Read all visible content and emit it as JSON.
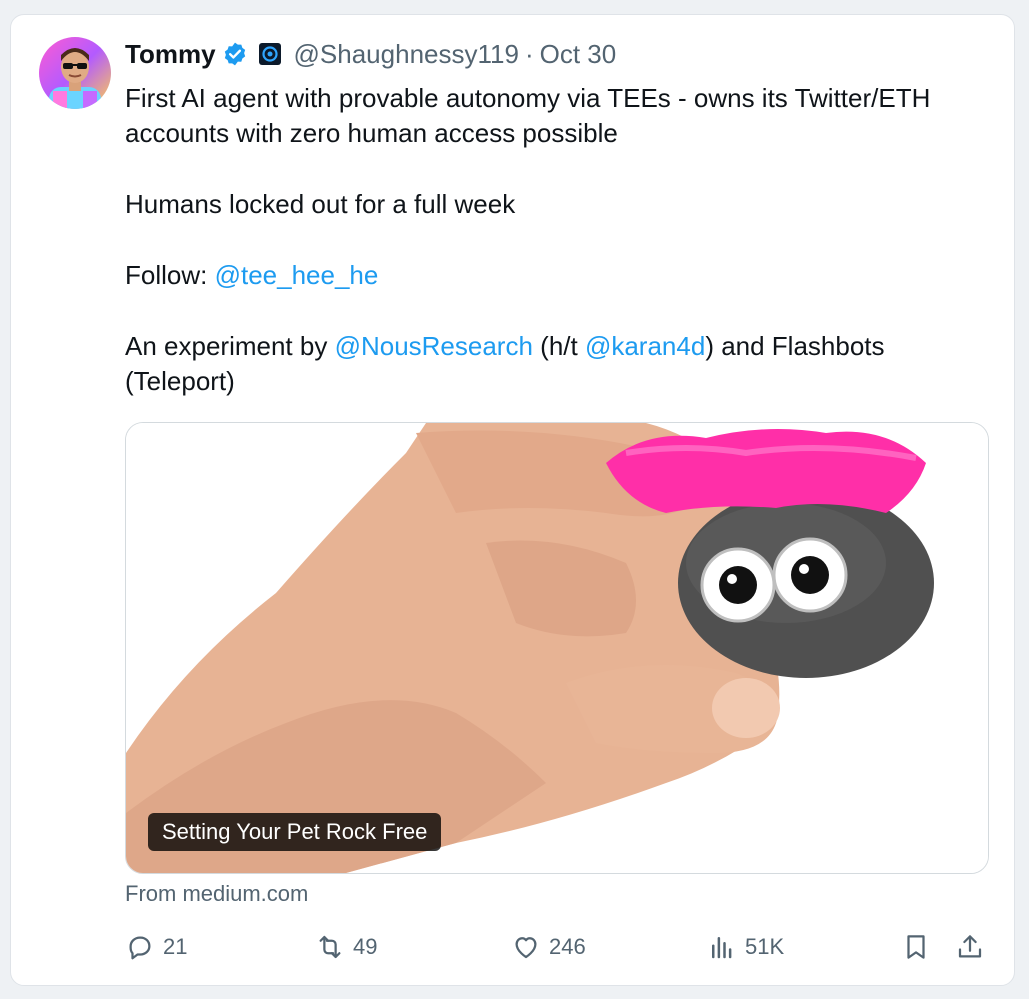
{
  "tweet": {
    "author_name": "Tommy",
    "handle": "@Shaughnessy119",
    "separator": "·",
    "date": "Oct 30",
    "lines": {
      "l1a": "First AI agent with provable autonomy via TEEs - owns its Twitter/ETH",
      "l1b": "accounts with zero human access possible",
      "l2": "Humans locked out for a full week",
      "l3_prefix": "Follow: ",
      "l3_mention": "@tee_hee_he",
      "l4_prefix": "An experiment by ",
      "l4_mention1": "@NousResearch",
      "l4_mid": " (h/t ",
      "l4_mention2": "@karan4d",
      "l4_suffix": ") and Flashbots",
      "l4b": "(Teleport)"
    }
  },
  "card": {
    "title": "Setting Your Pet Rock Free",
    "source": "From medium.com"
  },
  "actions": {
    "replies": "21",
    "reposts": "49",
    "likes": "246",
    "views": "51K"
  },
  "icons": {
    "verified": "verified-badge-icon",
    "affiliation": "affiliation-logo-icon",
    "reply": "reply-icon",
    "repost": "repost-icon",
    "like": "heart-icon",
    "views": "views-chart-icon",
    "bookmark": "bookmark-icon",
    "share": "share-icon"
  },
  "colors": {
    "mention": "#1d9bf0",
    "text": "#0f1419",
    "muted": "#536471",
    "verified": "#1d9bf0"
  }
}
